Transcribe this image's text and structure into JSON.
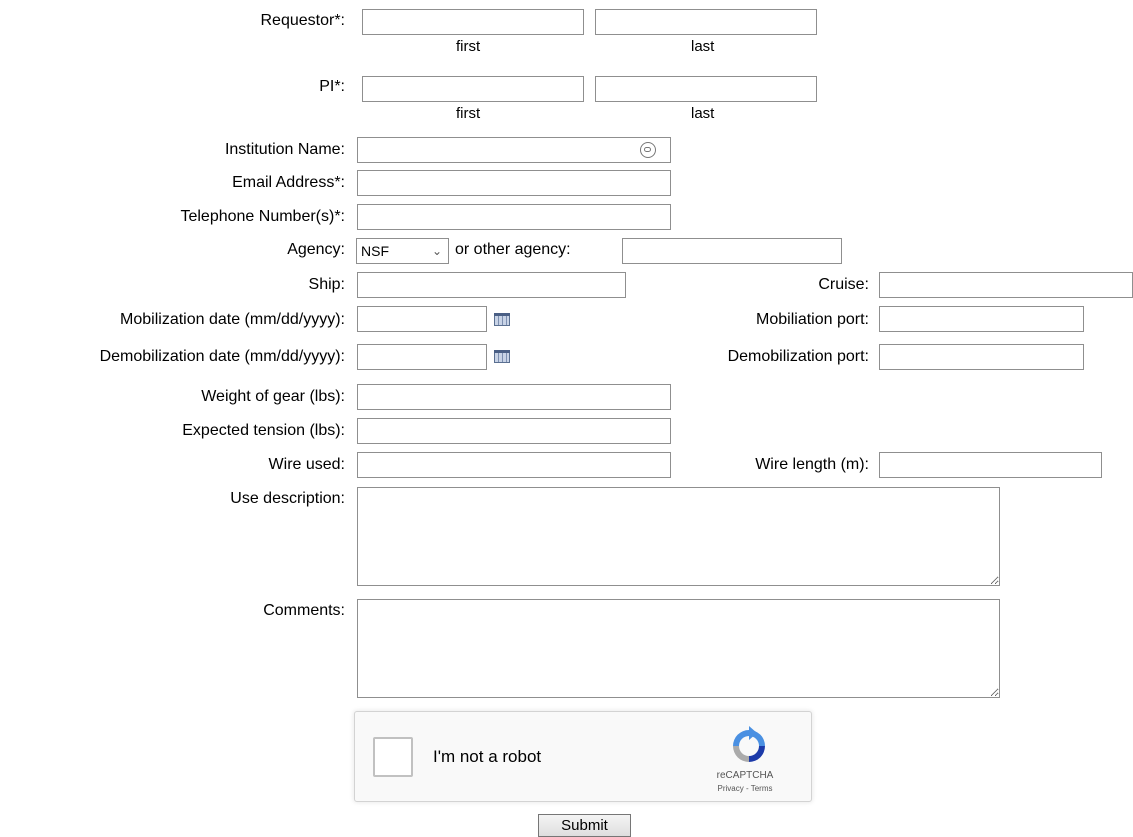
{
  "form": {
    "requestor": {
      "label": "Requestor*:",
      "first_caption": "first",
      "last_caption": "last",
      "first_value": "",
      "last_value": ""
    },
    "pi": {
      "label": "PI*:",
      "first_caption": "first",
      "last_caption": "last",
      "first_value": "",
      "last_value": ""
    },
    "institution": {
      "label": "Institution Name:",
      "value": "",
      "icon": "password-manager-icon"
    },
    "email": {
      "label": "Email Address*:",
      "value": ""
    },
    "telephone": {
      "label": "Telephone Number(s)*:",
      "value": ""
    },
    "agency": {
      "label": "Agency:",
      "selected": "NSF",
      "other_label": "or other agency:",
      "other_value": ""
    },
    "ship": {
      "label": "Ship:",
      "value": ""
    },
    "cruise": {
      "label": "Cruise:",
      "value": ""
    },
    "mob_date": {
      "label": "Mobilization date (mm/dd/yyyy):",
      "value": "",
      "icon": "calendar-icon"
    },
    "mob_port": {
      "label": "Mobiliation port:",
      "value": ""
    },
    "demob_date": {
      "label": "Demobilization date (mm/dd/yyyy):",
      "value": "",
      "icon": "calendar-icon"
    },
    "demob_port": {
      "label": "Demobilization port:",
      "value": ""
    },
    "weight": {
      "label": "Weight of gear (lbs):",
      "value": ""
    },
    "tension": {
      "label": "Expected tension (lbs):",
      "value": ""
    },
    "wire_used": {
      "label": "Wire used:",
      "value": ""
    },
    "wire_length": {
      "label": "Wire length (m):",
      "value": ""
    },
    "use_description": {
      "label": "Use description:",
      "value": ""
    },
    "comments": {
      "label": "Comments:",
      "value": ""
    }
  },
  "captcha": {
    "text": "I'm not a robot",
    "brand": "reCAPTCHA",
    "legal": "Privacy - Terms",
    "checked": false
  },
  "submit_label": "Submit"
}
